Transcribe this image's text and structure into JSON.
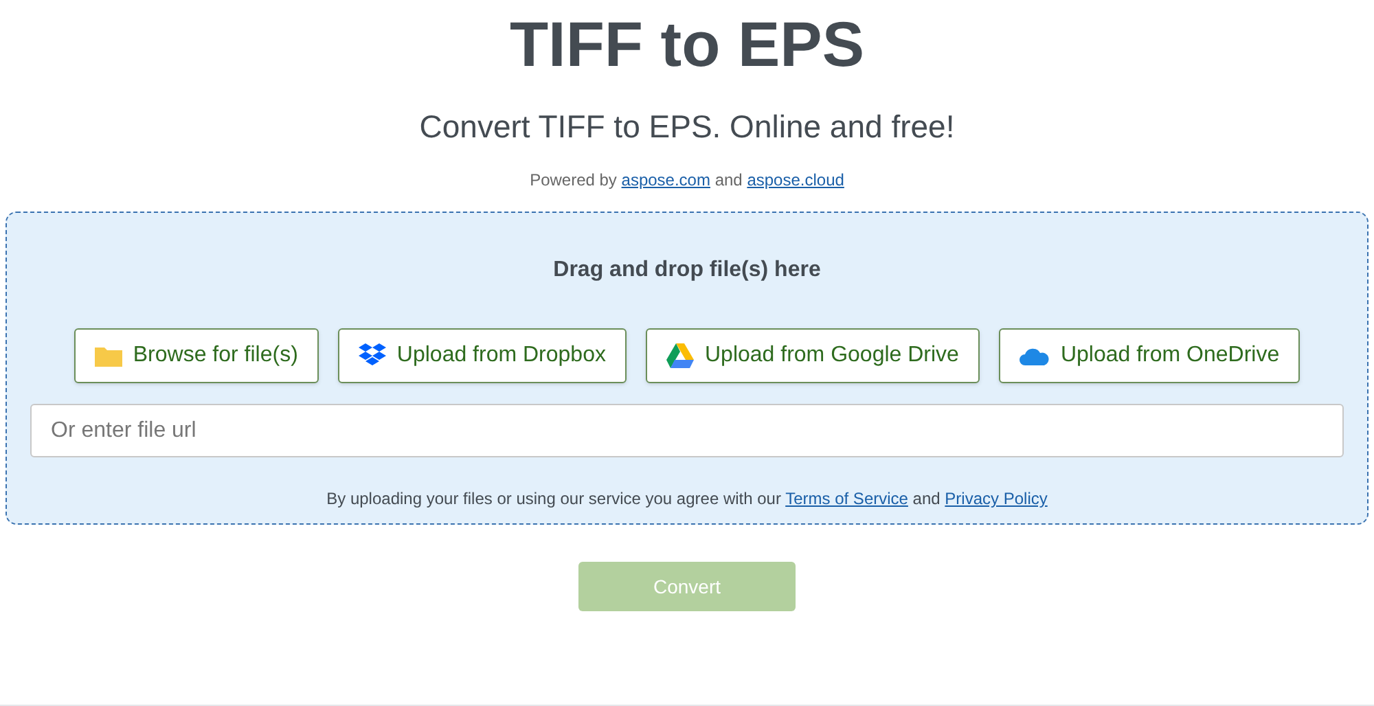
{
  "title": "TIFF to EPS",
  "subtitle": "Convert TIFF to EPS. Online and free!",
  "powered_by": [
    {
      "kind": "text",
      "text": "Powered by"
    },
    {
      "kind": "link",
      "text": "aspose.com"
    },
    {
      "kind": "text",
      "text": "and"
    },
    {
      "kind": "link",
      "text": "aspose.cloud"
    }
  ],
  "drop_zone": {
    "heading": "Drag and drop file(s) here",
    "buttons": [
      {
        "kind": "folder",
        "label": "Browse for file(s)"
      },
      {
        "kind": "dropbox",
        "label": "Upload from Dropbox"
      },
      {
        "kind": "gdrive",
        "label": "Upload from Google Drive"
      },
      {
        "kind": "onedrive",
        "label": "Upload from OneDrive"
      }
    ],
    "url_field": {
      "placeholder": "Or enter file url"
    },
    "terms": [
      {
        "kind": "text",
        "text": "By uploading your files or using our service you agree with our"
      },
      {
        "kind": "link",
        "text": "Terms of Service"
      },
      {
        "kind": "text",
        "text": "and"
      },
      {
        "kind": "link",
        "text": "Privacy Policy"
      }
    ]
  },
  "convert_button": {
    "label": "Convert",
    "disabled": true
  }
}
